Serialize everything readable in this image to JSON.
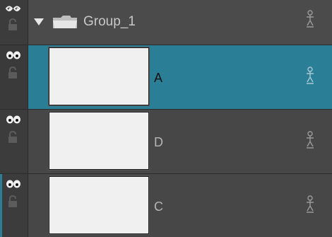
{
  "group": {
    "name": "Group_1",
    "expanded": true,
    "icons": [
      "eye-closed-icon",
      "lock-icon",
      "chevron-down-icon",
      "folder-icon",
      "puppet-icon"
    ]
  },
  "layers": [
    {
      "name": "A",
      "selected": true,
      "visible": true,
      "locked": false
    },
    {
      "name": "D",
      "selected": false,
      "visible": true,
      "locked": false
    },
    {
      "name": "C",
      "selected": false,
      "visible": true,
      "locked": false
    }
  ],
  "colors": {
    "selection": "#2a7f96",
    "panel": "#444444",
    "thumbnail": "#f0f0f0"
  }
}
